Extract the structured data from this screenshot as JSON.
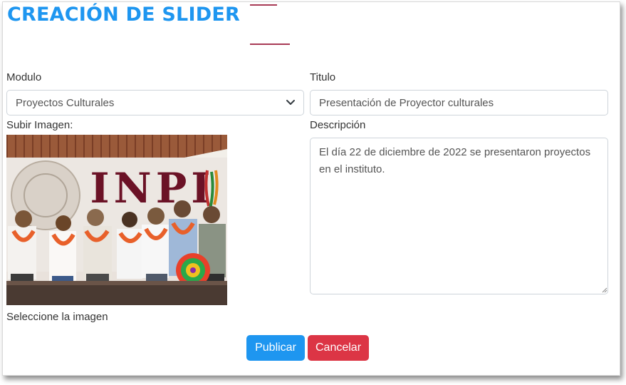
{
  "page": {
    "title": "CREACIÓN DE SLIDER"
  },
  "form": {
    "modulo": {
      "label": "Modulo",
      "selected": "Proyectos Culturales"
    },
    "titulo": {
      "label": "Titulo",
      "value": "Presentación de Proyector culturales"
    },
    "imagen": {
      "label": "Subir Imagen:",
      "hint": "Seleccione la imagen",
      "sign_text": "INPI"
    },
    "descripcion": {
      "label": "Descripción",
      "value": "El día 22 de diciembre de 2022 se presentaron proyectos en el instituto."
    }
  },
  "buttons": {
    "publish": "Publicar",
    "cancel": "Cancelar"
  },
  "colors": {
    "primary": "#1e96f0",
    "danger": "#dc3545",
    "accent_line": "#a83a56"
  },
  "icons": {
    "select_arrow": "chevron-down-icon",
    "textarea_resize": "resize-grip-icon"
  }
}
